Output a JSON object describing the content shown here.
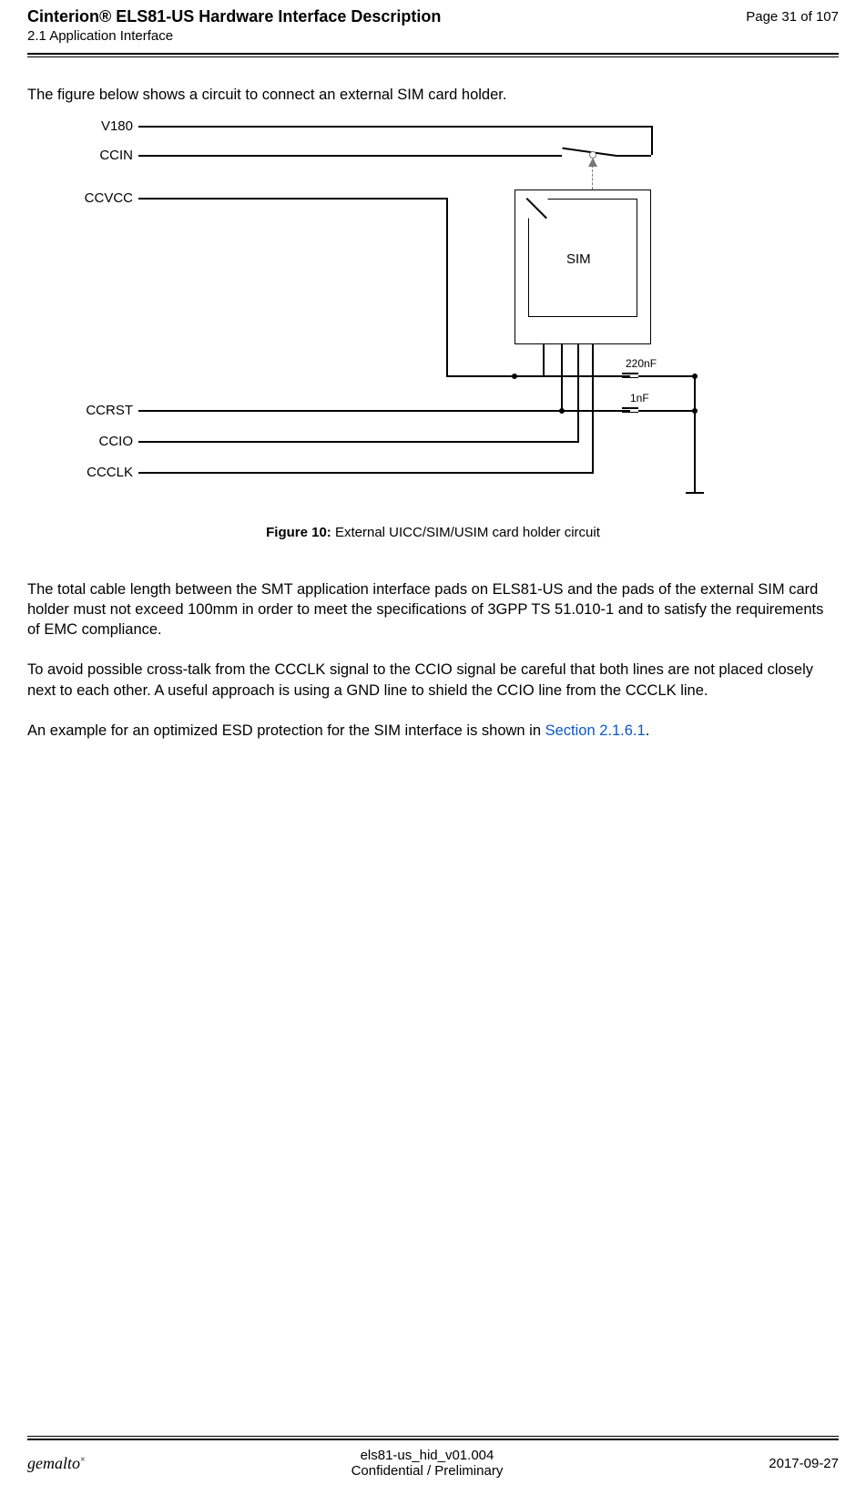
{
  "header": {
    "title": "Cinterion® ELS81-US Hardware Interface Description",
    "subtitle": "2.1 Application Interface",
    "page": "Page 31 of 107"
  },
  "intro": "The figure below shows a circuit to connect an external SIM card holder.",
  "signals": {
    "v180": "V180",
    "ccin": "CCIN",
    "ccvcc": "CCVCC",
    "ccrst": "CCRST",
    "ccio": "CCIO",
    "ccclk": "CCCLK"
  },
  "sim_label": "SIM",
  "caps": {
    "c1": "220nF",
    "c2": "1nF"
  },
  "figure": {
    "label": "Figure 10:",
    "caption": "External UICC/SIM/USIM card holder circuit"
  },
  "body": {
    "p1": "The total cable length between the SMT application interface pads on ELS81-US and the pads of the external SIM card holder must not exceed 100mm in order to meet the specifications of 3GPP TS 51.010-1 and to satisfy the requirements of EMC compliance.",
    "p2": "To avoid possible cross-talk from the CCCLK signal to the CCIO signal be careful that both lines are not placed closely next to each other. A useful approach is using a GND line to shield the CCIO line from the CCCLK line.",
    "p3_pre": "An example for an optimized ESD protection for the SIM interface is shown in ",
    "p3_link": "Section 2.1.6.1",
    "p3_post": "."
  },
  "footer": {
    "brand": "gemalto",
    "brand_sup": "×",
    "docid": "els81-us_hid_v01.004",
    "conf": "Confidential / Preliminary",
    "date": "2017-09-27"
  }
}
